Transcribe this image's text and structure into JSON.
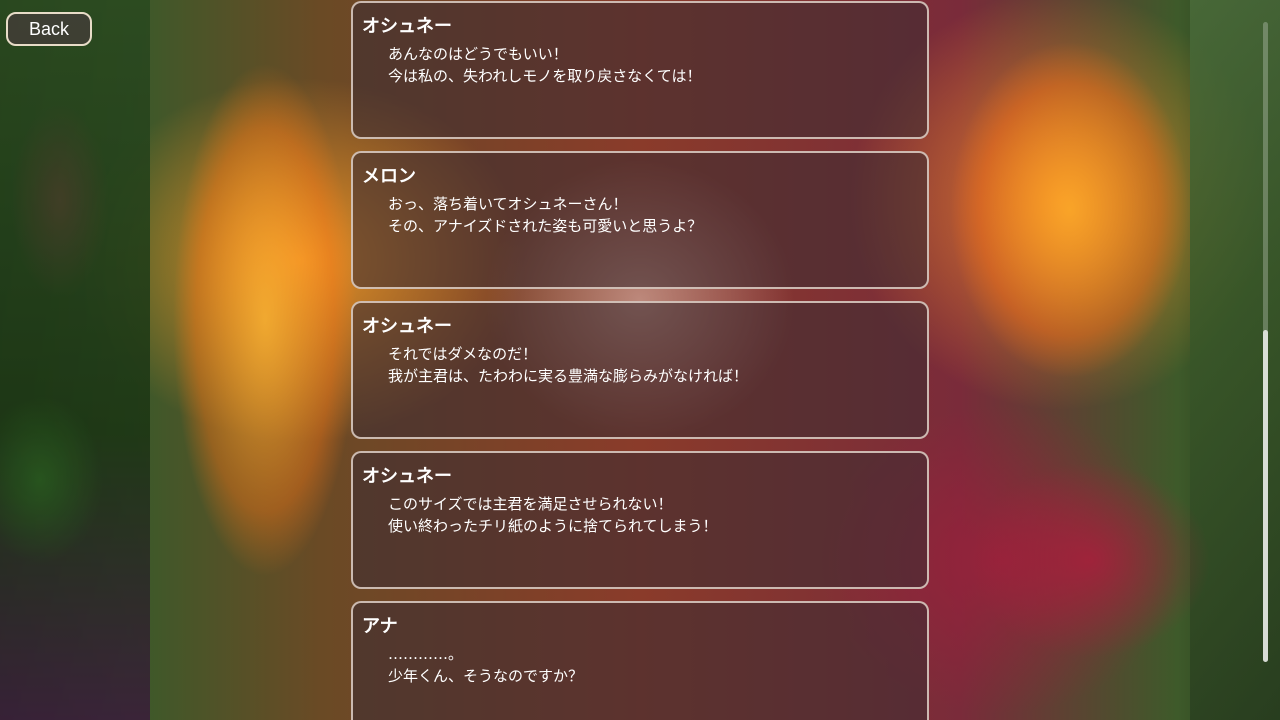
{
  "back_button": {
    "label": "Back"
  },
  "log": {
    "entries": [
      {
        "speaker": "オシュネー",
        "lines": [
          "あんなのはどうでもいい！",
          "今は私の、失われしモノを取り戻さなくては！"
        ]
      },
      {
        "speaker": "メロン",
        "lines": [
          "おっ、落ち着いてオシュネーさん！",
          "その、アナイズドされた姿も可愛いと思うよ？"
        ]
      },
      {
        "speaker": "オシュネー",
        "lines": [
          "それではダメなのだ！",
          "我が主君は、たわわに実る豊満な膨らみがなければ！"
        ]
      },
      {
        "speaker": "オシュネー",
        "lines": [
          "このサイズでは主君を満足させられない！",
          "使い終わったチリ紙のように捨てられてしまう！"
        ]
      },
      {
        "speaker": "アナ",
        "lines": [
          "…………。",
          "少年くん、そうなのですか？"
        ]
      }
    ]
  },
  "scrollbar": {
    "position_fraction": 0.52,
    "visible_fraction": 0.52
  },
  "colors": {
    "panel_border": "#e1d2c8",
    "text": "#ffffff"
  }
}
